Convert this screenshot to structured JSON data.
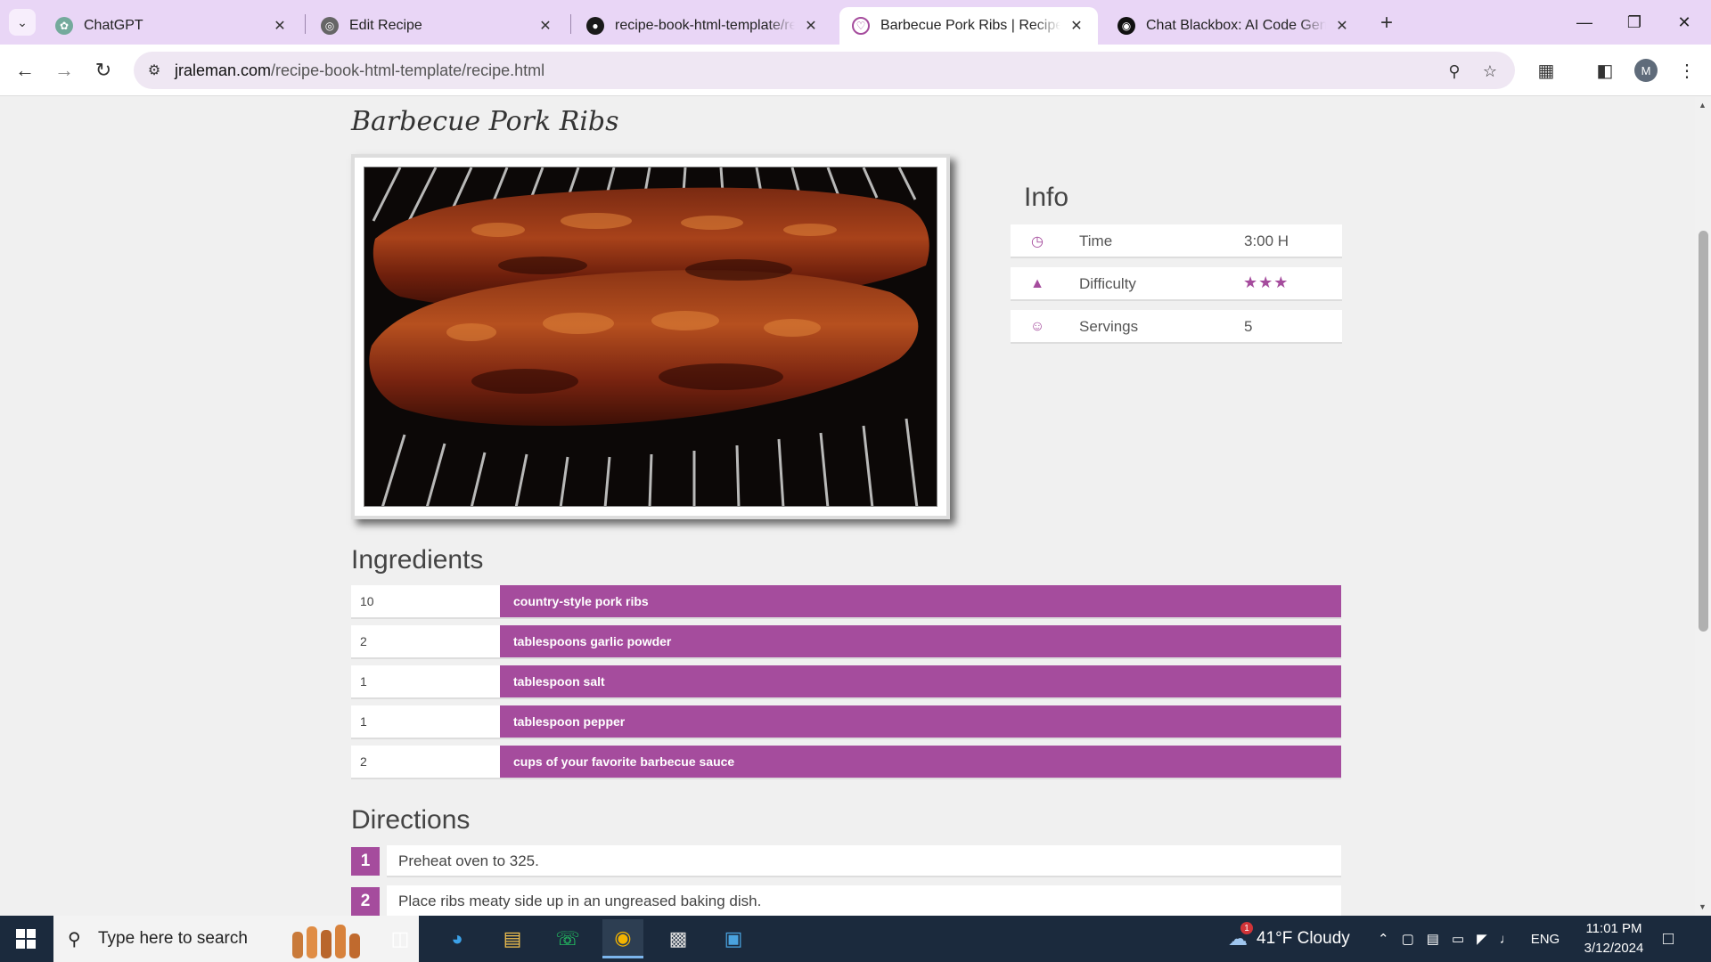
{
  "browser": {
    "tabs": [
      {
        "title": "ChatGPT",
        "icon": "chatgpt-icon"
      },
      {
        "title": "Edit Recipe",
        "icon": "globe-icon"
      },
      {
        "title": "recipe-book-html-template/rec",
        "icon": "github-icon"
      },
      {
        "title": "Barbecue Pork Ribs | Recipe Boo",
        "icon": "recipe-book-icon",
        "active": true
      },
      {
        "title": "Chat Blackbox: AI Code Generat",
        "icon": "blackbox-icon"
      }
    ],
    "url": {
      "host": "jraleman.com",
      "path": "/recipe-book-html-template/recipe.html"
    },
    "profile_initial": "M"
  },
  "recipe": {
    "title": "Barbecue Pork Ribs",
    "info": {
      "heading": "Info",
      "rows": [
        {
          "label": "Time",
          "value": "3:00 H",
          "icon": "clock-icon"
        },
        {
          "label": "Difficulty",
          "stars": 3,
          "icon": "chart-icon"
        },
        {
          "label": "Servings",
          "value": "5",
          "icon": "users-icon"
        }
      ]
    },
    "ingredients": {
      "heading": "Ingredients",
      "items": [
        {
          "qty": "10",
          "name": "country-style pork ribs"
        },
        {
          "qty": "2",
          "name": "tablespoons garlic powder"
        },
        {
          "qty": "1",
          "name": "tablespoon salt"
        },
        {
          "qty": "1",
          "name": "tablespoon pepper"
        },
        {
          "qty": "2",
          "name": "cups of your favorite barbecue sauce"
        }
      ]
    },
    "directions": {
      "heading": "Directions",
      "steps": [
        {
          "num": "1",
          "text": "Preheat oven to 325."
        },
        {
          "num": "2",
          "text": "Place ribs meaty side up in an ungreased baking dish."
        }
      ]
    }
  },
  "taskbar": {
    "search_placeholder": "Type here to search",
    "weather": "41°F  Cloudy",
    "weather_badge": "1",
    "language": "ENG",
    "time": "11:01 PM",
    "date": "3/12/2024"
  },
  "colors": {
    "accent": "#a54c9d",
    "tabstrip": "#e9d6f6",
    "taskbar": "#1b2a3d"
  }
}
